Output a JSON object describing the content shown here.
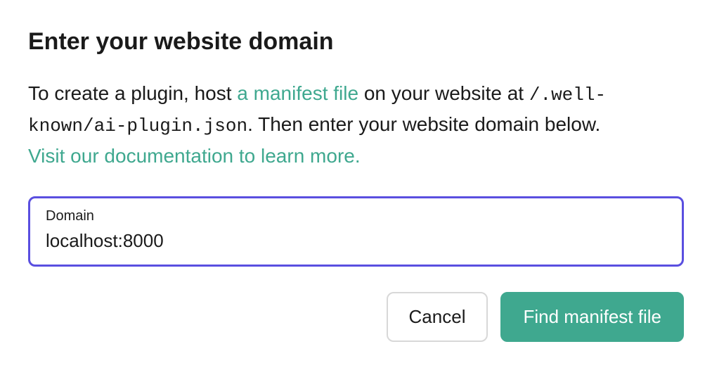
{
  "heading": "Enter your website domain",
  "description": {
    "part1": "To create a plugin, host ",
    "manifest_link_text": "a manifest file",
    "part2": " on your website at ",
    "code_path": "/.well-known/ai-plugin.json",
    "part3": ". Then enter your website domain below. ",
    "docs_link_text": "Visit our documentation to learn more."
  },
  "form": {
    "field_label": "Domain",
    "field_value": "localhost:8000"
  },
  "buttons": {
    "cancel": "Cancel",
    "primary": "Find manifest file"
  }
}
